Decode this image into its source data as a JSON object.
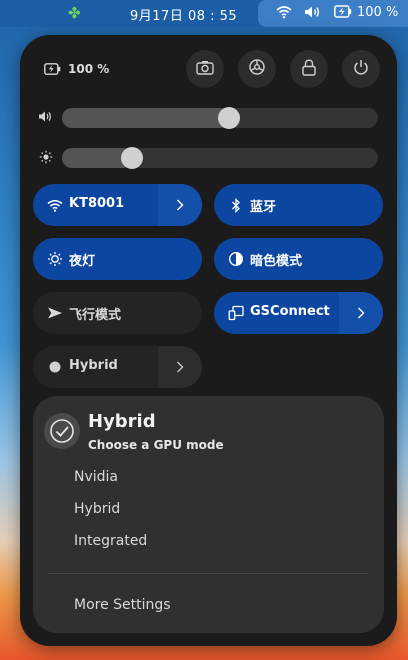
{
  "topbar": {
    "clover_icon": "clover-icon",
    "clock": "9月17日  08 : 55",
    "battery_percent": "100 %"
  },
  "panel": {
    "battery_label": "100 %",
    "header_buttons": [
      "screenshot-icon",
      "settings-icon",
      "lock-icon",
      "power-icon"
    ]
  },
  "sliders": {
    "volume": {
      "icon": "volume-icon",
      "level": 0.53
    },
    "brightness": {
      "icon": "brightness-icon",
      "level": 0.2
    }
  },
  "tiles": {
    "wifi": {
      "label": "KT8001",
      "active": true
    },
    "bluetooth": {
      "label": "蓝牙",
      "active": true
    },
    "night_light": {
      "label": "夜灯",
      "active": true
    },
    "dark_mode": {
      "label": "暗色模式",
      "active": true
    },
    "airplane": {
      "label": "飞行模式",
      "active": false
    },
    "gsconnect": {
      "label": "GSConnect",
      "active": true
    },
    "gpu": {
      "label": "Hybrid",
      "active": false
    }
  },
  "gpu_menu": {
    "title": "Hybrid",
    "subtitle": "Choose a GPU mode",
    "options": [
      "Nvidia",
      "Hybrid",
      "Integrated"
    ],
    "more_settings": "More Settings"
  },
  "colors": {
    "accent_blue": "#0d46a0",
    "panel_bg": "#1b1b1b",
    "menu_bg": "#303030"
  }
}
